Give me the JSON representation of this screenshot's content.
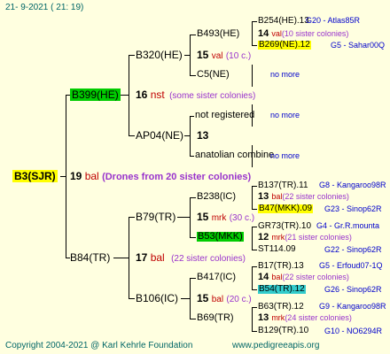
{
  "header": {
    "date": "21-  9-2021 ( 21: 19)"
  },
  "footer": {
    "copyright": "Copyright 2004-2021 @ Karl Kehrle Foundation",
    "website": "www.pedigreeapis.org"
  },
  "colors": {
    "background": "#FFFFE0",
    "highlight_yellow": "#FFFF00",
    "highlight_green": "#00CC00",
    "highlight_cyan": "#33CCCC",
    "red": "#C00000",
    "purple": "#9933CC",
    "blue": "#0000CC"
  },
  "root": {
    "name": "B3(SJR)",
    "gen": "19",
    "source": "bal",
    "note": "(Drones from 20 sister colonies)"
  },
  "g1": [
    {
      "name": "B399(HE)",
      "gen": "16",
      "source": "nst",
      "note": "(some sister colonies)"
    },
    {
      "name": "B84(TR)",
      "gen": "17",
      "source": "bal",
      "note": "(22 sister colonies)"
    }
  ],
  "g2": [
    {
      "name": "B320(HE)",
      "gen": "15",
      "source": "val",
      "note": "(10 c.)"
    },
    {
      "name": "AP04(NE)",
      "gen": "13"
    },
    {
      "name": "B79(TR)",
      "gen": "15",
      "source": "mrk",
      "note": "(30 c.)"
    },
    {
      "name": "B106(IC)",
      "gen": "15",
      "source": "bal",
      "note": "(20 c.)"
    }
  ],
  "g3": [
    {
      "name": "B493(HE)",
      "gen": "14",
      "source": "val",
      "note": "(10 sister colonies)"
    },
    {
      "name": "C5(NE)",
      "more": "no more"
    },
    {
      "name": "not registered",
      "more": "no more"
    },
    {
      "name": "anatolian combine",
      "more": "no more"
    },
    {
      "name": "B238(IC)",
      "gen": "13",
      "source": "bal",
      "note": "(22 sister colonies)"
    },
    {
      "name": "B53(MKK)",
      "gen": "12",
      "source": "mrk",
      "note": "(21 sister colonies)"
    },
    {
      "name": "B417(IC)",
      "gen": "14",
      "source": "bal",
      "note": "(22 sister colonies)"
    },
    {
      "name": "B69(TR)",
      "gen": "13",
      "source": "mrk",
      "note": "(24 sister colonies)"
    }
  ],
  "g4": [
    {
      "name": "B254(HE).13",
      "id": "G20 - Atlas85R"
    },
    {
      "name": "B269(NE).12",
      "id": "G5 - Sahar00Q"
    },
    {
      "name": "B137(TR).11",
      "id": "G8 - Kangaroo98R"
    },
    {
      "name": "B47(MKK).09",
      "id": "G23 - Sinop62R"
    },
    {
      "name": "GR73(TR).10",
      "id": "G4 - Gr.R.mounta"
    },
    {
      "name": "ST114.09",
      "id": "G22 - Sinop62R"
    },
    {
      "name": "B17(TR).13",
      "id": "G5 - Erfoud07-1Q"
    },
    {
      "name": "B54(TR).12",
      "id": "G26 - Sinop62R"
    },
    {
      "name": "B63(TR).12",
      "id": "G9 - Kangaroo98R"
    },
    {
      "name": "B129(TR).10",
      "id": "G10 - NO6294R"
    }
  ]
}
